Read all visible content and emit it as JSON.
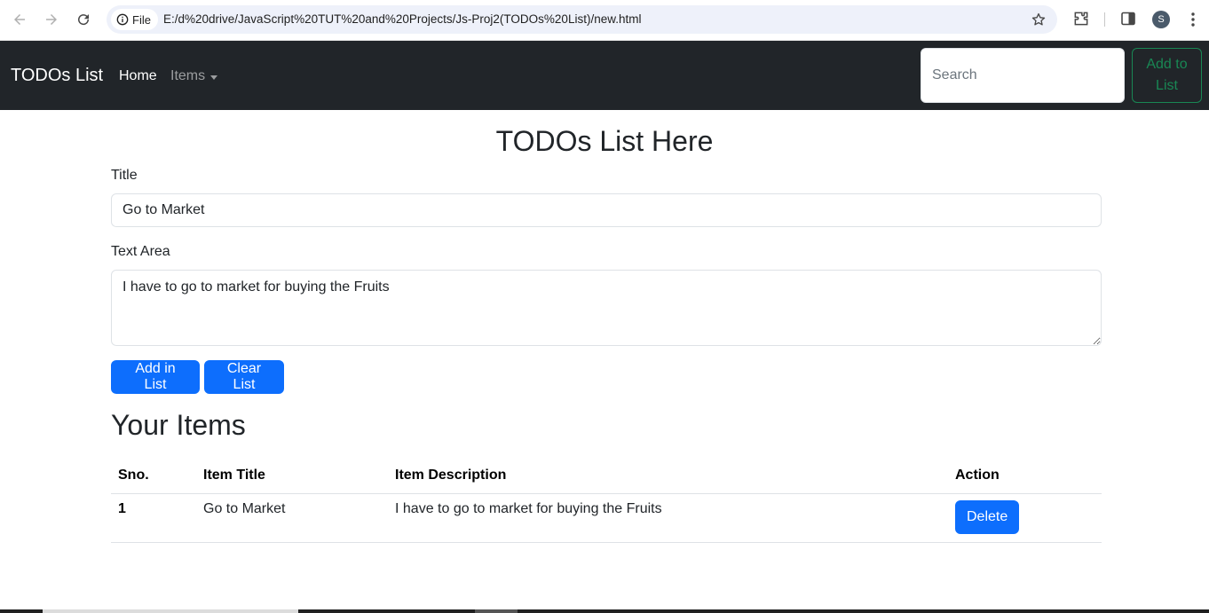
{
  "browser": {
    "site_chip_label": "File",
    "url": "E:/d%20drive/JavaScript%20TUT%20and%20Projects/Js-Proj2(TODOs%20List)/new.html",
    "profile_initial": "S"
  },
  "navbar": {
    "brand": "TODOs List",
    "home": "Home",
    "items_dropdown": "Items",
    "search_placeholder": "Search",
    "add_to_list_label": "Add to List"
  },
  "form": {
    "heading": "TODOs List Here",
    "title_label": "Title",
    "title_value": "Go to Market",
    "textarea_label": "Text Area",
    "textarea_value": "I have to go to market for buying the Fruits",
    "add_button": "Add in List",
    "clear_button": "Clear List"
  },
  "items": {
    "heading": "Your Items",
    "columns": [
      "Sno.",
      "Item Title",
      "Item Description",
      "Action"
    ],
    "rows": [
      {
        "sno": "1",
        "title": "Go to Market",
        "description": "I have to go to market for buying the Fruits",
        "action": "Delete"
      }
    ]
  },
  "colors": {
    "navbar_bg": "#212529",
    "primary": "#0d6efd",
    "success_outline": "#198754"
  }
}
